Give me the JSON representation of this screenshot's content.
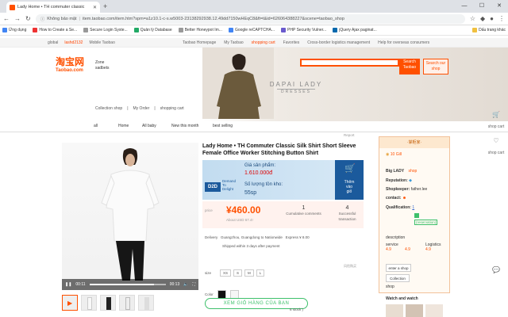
{
  "browser": {
    "tab_title": "Lady Home • TH commuter classic",
    "url_prefix": "Không bảo mật",
    "url": "item.taobao.com/item.htm?spm=a1z10.1-c-s.w5003-23138292938.12.49dd7150wHEqC8&ft=t&id=626064388227&scene=taobao_shop",
    "bookmarks": [
      "Ứng dụng",
      "How to Create a Se...",
      "Secure Login Syste...",
      "Quản lý Database",
      "Better Honeypot Im...",
      "Google reCAPTCHA...",
      "PHP Security Vulner...",
      "jQuery Ajax paginat..."
    ],
    "bookmark_right": "Dấu trang khác"
  },
  "taobao_top": {
    "left": [
      "global",
      "lashd2132",
      "Mobile Taobao"
    ],
    "right": [
      "Taobao Homepage",
      "My Taobao",
      "shopping cart",
      "Favorites",
      "Cross-border logistics management",
      "Help for overseas consumers"
    ]
  },
  "header": {
    "logo_cn": "淘宝网",
    "logo_en": "Taobao.com",
    "zone_1": "Zone",
    "zone_2": "sadbets",
    "search_btn_1": "Search",
    "search_btn_2": "Taobao",
    "shop_btn_1": "Search our",
    "shop_btn_2": "shop",
    "brand_1": "DAPAI LADY",
    "brand_2": "DRESSES",
    "collection": [
      "Collection shop",
      "My Order",
      "shopping cart"
    ]
  },
  "subnav": [
    "all",
    "Home",
    "All baby",
    "New this month",
    "best selling"
  ],
  "report": "Report",
  "right_side": [
    "shop cart",
    "shop cart"
  ],
  "video": {
    "time_current": "00:11",
    "time_total": "00:13",
    "progress": 0.85
  },
  "product": {
    "title": "Lady Home • TH Commuter Classic Silk Shirt Short Sleeve Female Office Worker Stitching Button Shirt",
    "d2d": {
      "logo": "D2D",
      "tag_1": "Demand",
      "tag_2": "To",
      "tag_3": "Delight",
      "price_label": "Giá sản phẩm:",
      "price": "1.610.000đ",
      "stock_label": "Số lượng tồn kho:",
      "stock": "55sp",
      "cart_1": "Thêm",
      "cart_2": "vào",
      "cart_3": "giỏ"
    },
    "price_label": "price",
    "price": "¥460.00",
    "price_usd": "About USD 67.4!",
    "cumulative_count": "1",
    "cumulative_label": "Cumulative comments",
    "success_count": "4",
    "success_label": "Successful transaction",
    "delivery_label": "Delivery",
    "delivery_text": "Guangzhou, Guangdong to Nationwide",
    "express": "Express ¥ 8.00",
    "shipped": "Shipped within 3 days after payment",
    "sale_note": "风险购买",
    "size_label": "size",
    "sizes": [
      "XS",
      "S",
      "M",
      "L"
    ],
    "color_label": "Color",
    "cart_button": "XEM GIỎ HÀNG CỦA BẠN",
    "stock_note": "6 stock )"
  },
  "shop": {
    "header": "·掌柜家·",
    "credit": "10 Gill",
    "name": "Big LADY",
    "shop_link": "shop",
    "reputation_label": "Reputation:",
    "shopkeeper_label": "Shopkeeper:",
    "shopkeeper": "father.lee",
    "contact_label": "contact:",
    "qualification_label": "Qualification:",
    "qualification_val": "1",
    "reservation": "(reservation)",
    "description_label": "description",
    "description_val": "4.9",
    "service_label": "service",
    "service_val": "4.9",
    "logistics_label": "Logistics",
    "logistics_val": "4.9",
    "enter_shop": "enter a shop",
    "collection_btn": "Collection",
    "shop_label": "shop",
    "watch_label": "Watch and watch"
  },
  "colors": {
    "taobao_orange": "#ff5000",
    "d2d_blue": "#1b5a9c",
    "cart_green": "#3ec06b"
  }
}
